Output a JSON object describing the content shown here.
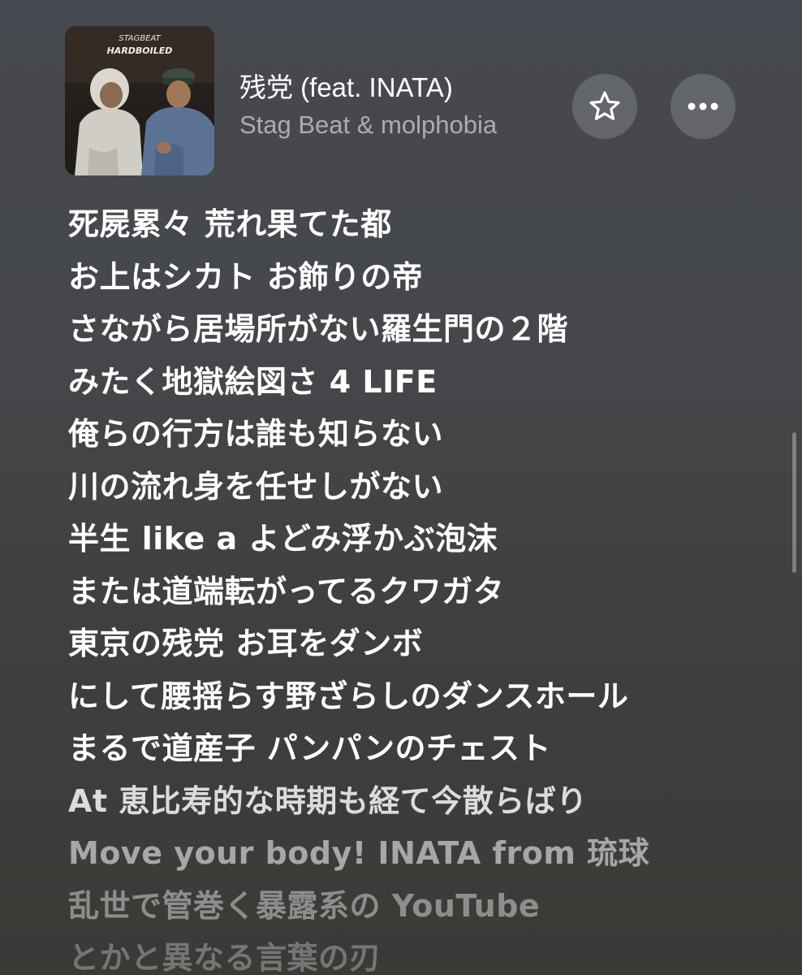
{
  "track": {
    "title": "残党 (feat. INATA)",
    "artist": "Stag Beat & molphobia",
    "artwork_text": "ᴴᴬᴿᴰᴮᴼᴵᴸᴱᴰ"
  },
  "actions": {
    "favorite_icon": "star-icon",
    "more_icon": "ellipsis-icon"
  },
  "lyrics": [
    "死屍累々 荒れ果てた都",
    "お上はシカト お飾りの帝",
    "さながら居場所がない羅生門の２階",
    "みたく地獄絵図さ 4 LIFE",
    "俺らの行方は誰も知らない",
    "川の流れ身を任せしがない",
    "半生 like a よどみ浮かぶ泡沫",
    "または道端転がってるクワガタ",
    "東京の残党 お耳をダンボ",
    "にして腰揺らす野ざらしのダンスホール",
    "まるで道産子 パンパンのチェスト",
    "At 恵比寿的な時期も経て今散らばり",
    "Move your body! INATA from 琉球",
    "乱世で管巻く暴露系の YouTube",
    "とかと異なる言葉の刃"
  ],
  "colors": {
    "background_top": "#46494f",
    "background_bottom": "#3c3a37",
    "lyric_active": "#ffffff"
  }
}
